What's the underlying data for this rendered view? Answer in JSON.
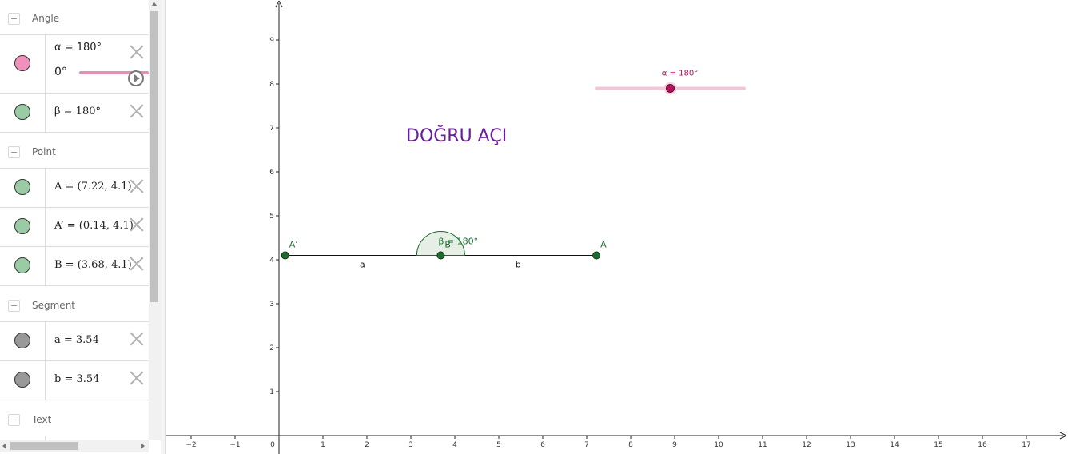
{
  "algebra": {
    "categories": {
      "angle": "Angle",
      "point": "Point",
      "segment": "Segment",
      "text": "Text"
    },
    "rows": {
      "alpha": "α = 180°",
      "alpha_slider_min": "0°",
      "beta": "β = 180°",
      "A": "A = (7.22, 4.1)",
      "A_prime": "A’ = (0.14, 4.1)",
      "B": "B = (3.68, 4.1)",
      "a": "a = 3.54",
      "b": "b = 3.54"
    }
  },
  "graphics": {
    "title": "DOĞRU AÇI",
    "slider_label": "α = 180°",
    "slider_value": 180,
    "angle_label": "β = 180°",
    "points": [
      {
        "name": "A'",
        "x": 0.14,
        "y": 4.1
      },
      {
        "name": "B",
        "x": 3.68,
        "y": 4.1
      },
      {
        "name": "A",
        "x": 7.22,
        "y": 4.1
      }
    ],
    "segment_labels": [
      "a",
      "b"
    ],
    "x_ticks": [
      "-2",
      "-1",
      "0",
      "1",
      "2",
      "3",
      "4",
      "5",
      "6",
      "7",
      "8",
      "9",
      "10",
      "11",
      "12",
      "13",
      "14",
      "15",
      "16",
      "17"
    ],
    "y_ticks": [
      "1",
      "2",
      "3",
      "4",
      "5",
      "6",
      "7",
      "8",
      "9"
    ]
  },
  "colors": {
    "alpha": "#e58fb4",
    "green_object": "#99c9a3",
    "segment": "#999999",
    "title": "#6b1e9b",
    "point_fill": "#1f6b2f"
  }
}
